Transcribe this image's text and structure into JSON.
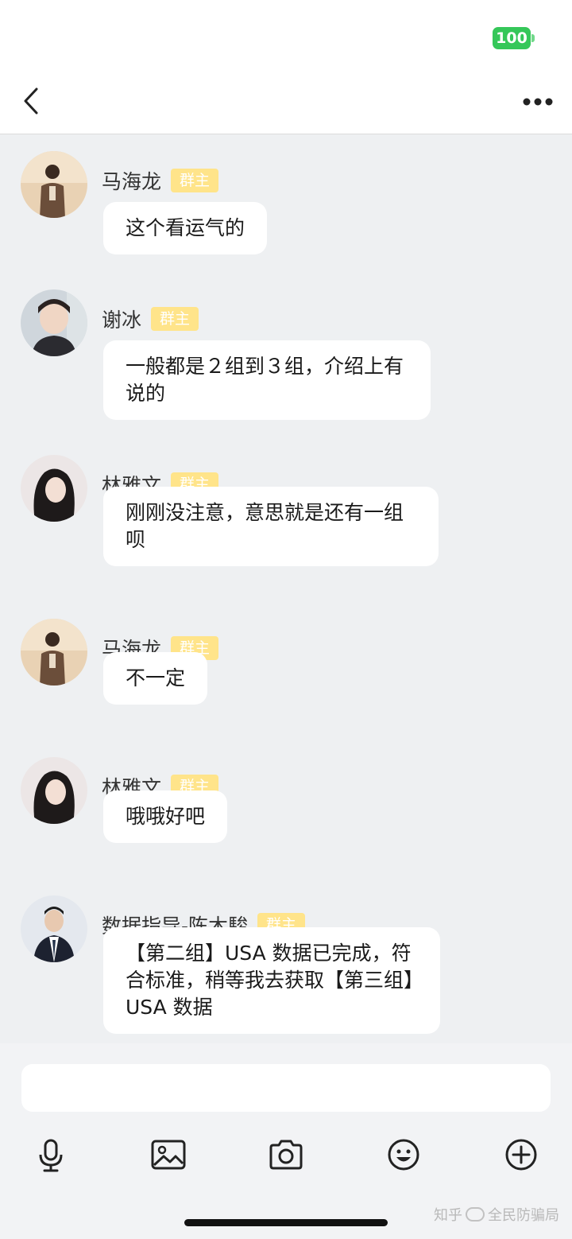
{
  "status_bar": {
    "battery": "100"
  },
  "nav": {
    "back_icon": "chevron-left-icon",
    "more_icon": "more-dots-icon"
  },
  "messages": [
    {
      "sender": "马海龙",
      "role": "群主",
      "text": "这个看运气的"
    },
    {
      "sender": "谢冰",
      "role": "群主",
      "text": "一般都是２组到３组，介绍上有说的"
    },
    {
      "sender": "林雅文",
      "role": "群主",
      "text": "刚刚没注意，意思就是还有一组呗"
    },
    {
      "sender": "马海龙",
      "role": "群主",
      "text": "不一定"
    },
    {
      "sender": "林雅文",
      "role": "群主",
      "text": "哦哦好吧"
    },
    {
      "sender": "数据指导-陈木駿",
      "role": "群主",
      "text": "【第二组】USA 数据已完成，符合标准，稍等我去获取【第三组】USA 数据"
    }
  ],
  "input": {
    "placeholder": ""
  },
  "toolbar": [
    "microphone-icon",
    "image-icon",
    "camera-icon",
    "emoji-icon",
    "plus-circle-icon"
  ],
  "watermark": {
    "text_a": "知乎",
    "text_b": "全民防骗局"
  },
  "colors": {
    "badge": "#ffe48a",
    "battery": "#35c759",
    "background": "#eef0f2"
  }
}
